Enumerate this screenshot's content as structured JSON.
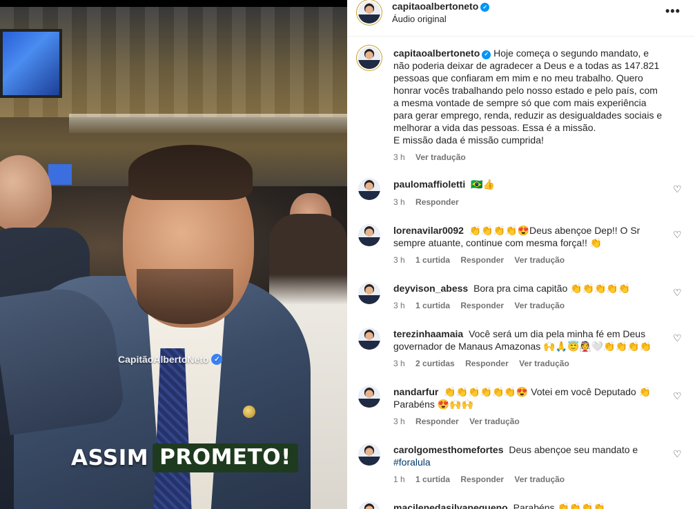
{
  "video": {
    "watermark": "CapitãoAlbertoNeto",
    "caption_word1": "ASSIM",
    "caption_word2": "PROMETO!"
  },
  "post_header": {
    "username": "capitaoalbertoneto",
    "subtitle": "Áudio original",
    "more_label": "•••"
  },
  "post_caption": {
    "username": "capitaoalbertoneto",
    "text_l1": "Hoje começa o segundo mandato, e",
    "text_l2": "não poderia deixar de agradecer a Deus e a todas as 147.821",
    "text_l3": "pessoas que confiaram em mim e no meu trabalho. Quero",
    "text_l4": "honrar vocês trabalhando pelo nosso estado e pelo país, com",
    "text_l5": "a mesma vontade de sempre só que com mais experiência",
    "text_l6": "para gerar emprego, renda, reduzir as desigualdades sociais e",
    "text_l7": "melhorar a vida das pessoas. Essa é a missão.",
    "text_l8": "E missão dada é missão cumprida!",
    "time": "3 h",
    "translate": "Ver tradução"
  },
  "comments": [
    {
      "username": "paulomaffioletti",
      "text": "🇧🇷👍",
      "time": "3 h",
      "reply": "Responder"
    },
    {
      "username": "lorenavilar0092",
      "text": "👏👏👏👏😍Deus abençoe Dep!! O Sr sempre atuante, continue com mesma força!! 👏",
      "time": "3 h",
      "likes": "1 curtida",
      "reply": "Responder",
      "translate": "Ver tradução"
    },
    {
      "username": "deyvison_abess",
      "text": "Bora pra cima capitão 👏👏👏👏👏",
      "time": "3 h",
      "likes": "1 curtida",
      "reply": "Responder",
      "translate": "Ver tradução"
    },
    {
      "username": "terezinhaamaia",
      "text": "Você será um dia pela minha fé em Deus governador de Manaus Amazonas 🙌🙏😇👰🤍👏👏👏👏",
      "time": "3 h",
      "likes": "2 curtidas",
      "reply": "Responder",
      "translate": "Ver tradução"
    },
    {
      "username": "nandarfur",
      "text": "👏👏👏👏👏👏😍 Votei em você Deputado 👏 Parabéns 😍🙌🙌",
      "time": "3 h",
      "reply": "Responder",
      "translate": "Ver tradução"
    },
    {
      "username": "carolgomesthomefortes",
      "text": "Deus abençoe seu mandato e",
      "hashtag": "#foralula",
      "time": "1 h",
      "likes": "1 curtida",
      "reply": "Responder",
      "translate": "Ver tradução"
    },
    {
      "username": "macilenedasilvapequeno",
      "text": "Parabéns 👏👏👏👏"
    }
  ],
  "icons": {
    "heart": "♡",
    "verified": "✓"
  }
}
